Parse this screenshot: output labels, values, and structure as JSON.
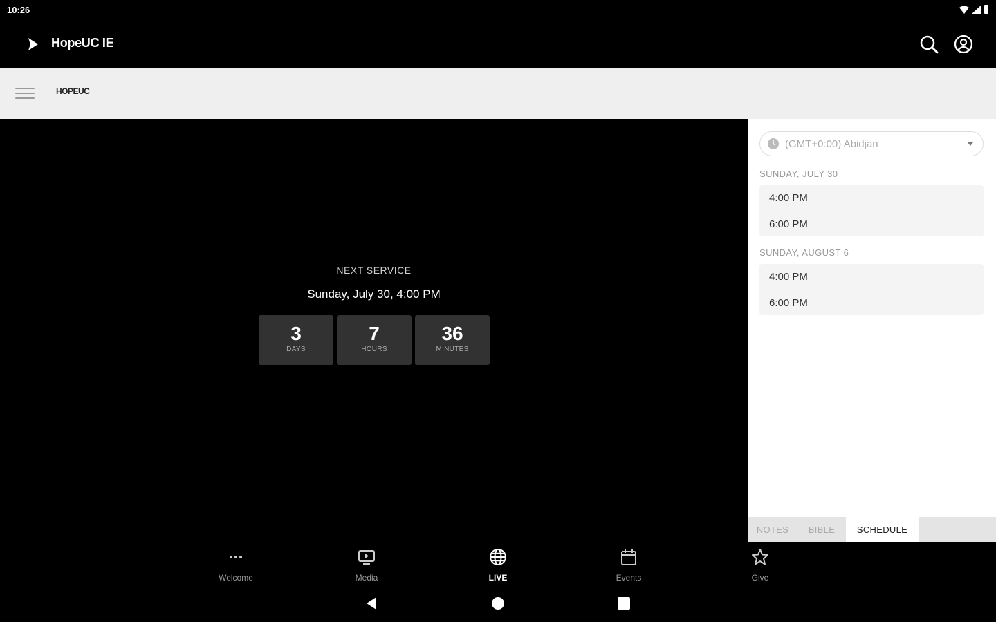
{
  "status_bar": {
    "time": "10:26"
  },
  "app_bar": {
    "title": "HopeUC IE"
  },
  "sub_bar": {
    "logo_text": "HOPEUC"
  },
  "countdown": {
    "label": "NEXT SERVICE",
    "date": "Sunday, July 30, 4:00 PM",
    "units": [
      {
        "value": "3",
        "label": "DAYS"
      },
      {
        "value": "7",
        "label": "HOURS"
      },
      {
        "value": "36",
        "label": "MINUTES"
      }
    ]
  },
  "schedule": {
    "timezone": "(GMT+0:00) Abidjan",
    "days": [
      {
        "label": "SUNDAY, JULY 30",
        "times": [
          "4:00 PM",
          "6:00 PM"
        ]
      },
      {
        "label": "SUNDAY, AUGUST 6",
        "times": [
          "4:00 PM",
          "6:00 PM"
        ]
      }
    ]
  },
  "tabs": [
    {
      "label": "NOTES",
      "active": false
    },
    {
      "label": "BIBLE",
      "active": false
    },
    {
      "label": "SCHEDULE",
      "active": true
    }
  ],
  "bottom_nav": [
    {
      "label": "Welcome",
      "icon": "more-dots-icon",
      "active": false
    },
    {
      "label": "Media",
      "icon": "tv-icon",
      "active": false
    },
    {
      "label": "LIVE",
      "icon": "globe-icon",
      "active": true
    },
    {
      "label": "Events",
      "icon": "calendar-icon",
      "active": false
    },
    {
      "label": "Give",
      "icon": "star-icon",
      "active": false
    }
  ],
  "colors": {
    "background": "#000000",
    "sub_bar": "#efefef",
    "countdown_box": "#323232",
    "panel": "#ffffff",
    "tab_bar": "#e4e4e4"
  }
}
